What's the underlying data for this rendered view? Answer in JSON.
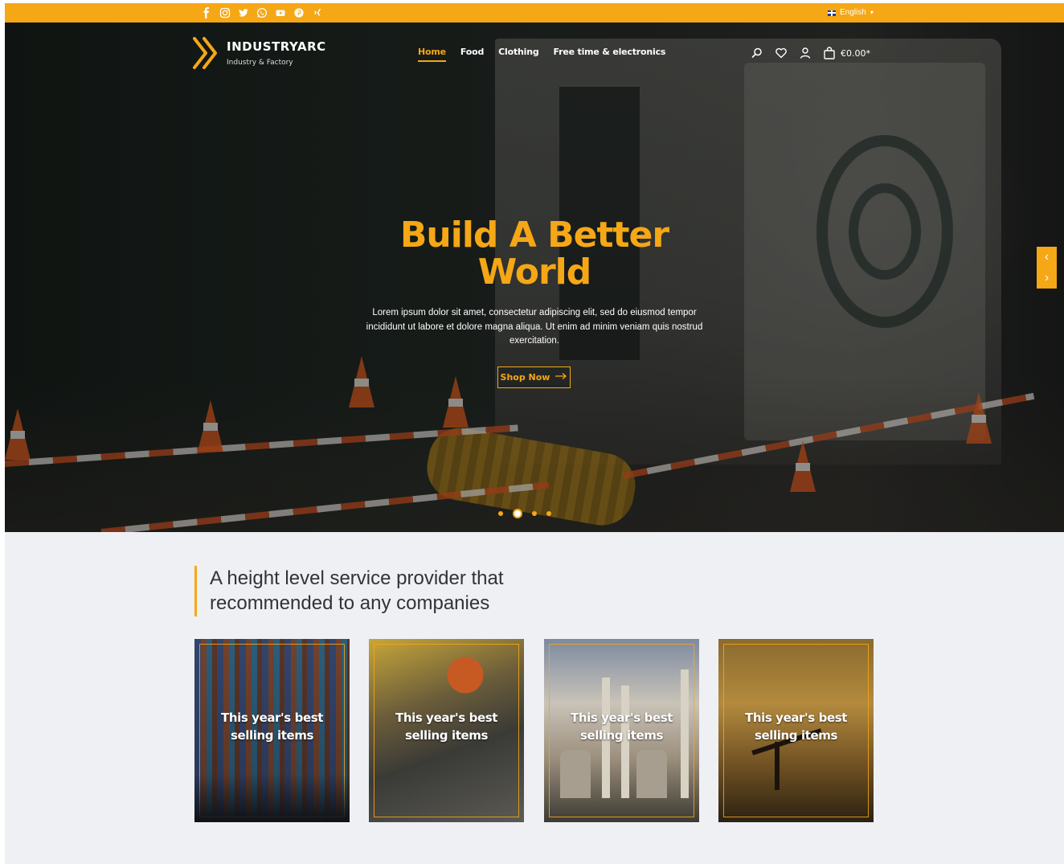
{
  "colors": {
    "accent": "#f5a716",
    "section_bg": "#eef0f4"
  },
  "topbar": {
    "social_icons": [
      "facebook-icon",
      "instagram-icon",
      "twitter-icon",
      "whatsapp-icon",
      "youtube-icon",
      "pinterest-icon",
      "xing-icon"
    ],
    "language": "English"
  },
  "header": {
    "logo_title": "INDUSTRYARC",
    "logo_subtitle": "Industry & Factory",
    "nav": [
      {
        "label": "Home",
        "active": true
      },
      {
        "label": "Food",
        "active": false
      },
      {
        "label": "Clothing",
        "active": false
      },
      {
        "label": "Free time & electronics",
        "active": false
      }
    ],
    "cart_total": "€0.00*"
  },
  "hero": {
    "title_line1": "Build A Better",
    "title_line2": "World",
    "text": "Lorem ipsum dolor sit amet, consectetur adipiscing elit, sed do eiusmod tempor incididunt ut labore et dolore magna aliqua. Ut enim ad minim veniam quis nostrud exercitation.",
    "button_label": "Shop Now",
    "slide_count": 4,
    "active_slide": 2
  },
  "section": {
    "headline_line1": "A height level service provider that",
    "headline_line2": "recommended to any companies",
    "cards": [
      {
        "line1": "This year's best",
        "line2": "selling items"
      },
      {
        "line1": "This year's best",
        "line2": "selling items"
      },
      {
        "line1": "This year's best",
        "line2": "selling items"
      },
      {
        "line1": "This year's best",
        "line2": "selling items"
      }
    ]
  }
}
